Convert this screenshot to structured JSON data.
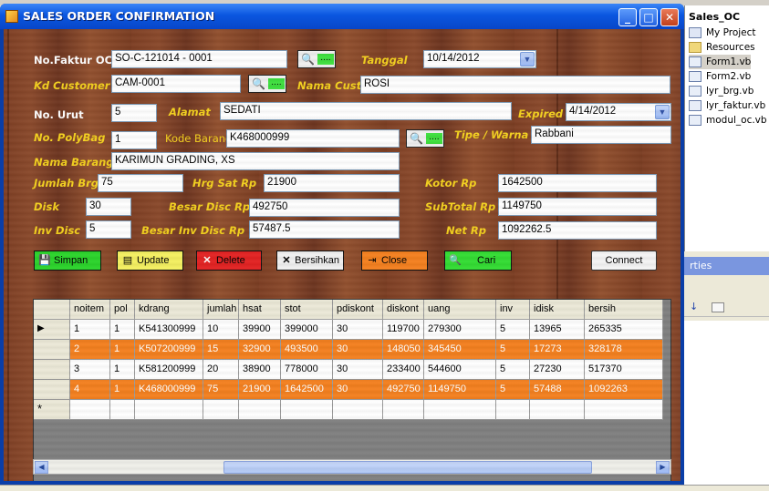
{
  "window": {
    "title": "SALES ORDER CONFIRMATION"
  },
  "solution": {
    "title": "Sales_OC",
    "items": [
      "My Project",
      "Resources",
      "Form1.vb",
      "Form2.vb",
      "lyr_brg.vb",
      "lyr_faktur.vb",
      "modul_oc.vb"
    ]
  },
  "props": {
    "title": "rties"
  },
  "labels": {
    "no_faktur": "No.Faktur OC",
    "tanggal": "Tanggal",
    "kd_customer": "Kd Customer",
    "nama_cust": "Nama Cust",
    "no_urut": "No. Urut",
    "alamat": "Alamat",
    "expired": "Expired",
    "no_polybag": "No. PolyBag",
    "kode_barang": "Kode Barang",
    "tipe_warna": "Tipe / Warna",
    "nama_barang": "Nama Barang",
    "jumlah_brg": "Jumlah Brg",
    "hrg_sat": "Hrg Sat  Rp",
    "kotor": "Kotor  Rp",
    "disk": "Disk",
    "besar_disc": "Besar Disc  Rp",
    "subtotal": "SubTotal  Rp",
    "inv_disc": "Inv Disc",
    "besar_inv_disc": "Besar Inv Disc  Rp",
    "net": "Net   Rp"
  },
  "fields": {
    "no_faktur": "SO-C-121014 - 0001",
    "tanggal": "10/14/2012",
    "kd_customer": "CAM-0001",
    "nama_cust": "ROSI",
    "no_urut": "5",
    "alamat": "SEDATI",
    "expired": "4/14/2012",
    "no_polybag": "1",
    "kode_barang": "K468000999",
    "tipe_warna": "Rabbani",
    "nama_barang": "KARIMUN GRADING, XS",
    "jumlah_brg": "75",
    "hrg_sat": "21900",
    "kotor": "1642500",
    "disk": "30",
    "besar_disc": "492750",
    "subtotal": "1149750",
    "inv_disc": "5",
    "besar_inv_disc": "57487.5",
    "net": "1092262.5"
  },
  "search_button_text": "....",
  "buttons": {
    "simpan": "Simpan",
    "update": "Update",
    "delete": "Delete",
    "bersihkan": "Bersihkan",
    "close": "Close",
    "cari": "Cari",
    "connect": "Connect"
  },
  "colors": {
    "simpan": "#2bd42b",
    "update": "#f4f060",
    "delete": "#e32222",
    "bersihkan": "#f0f0f0",
    "close": "#f4801f",
    "cari": "#33dd33",
    "connect": "#f4f4f4",
    "row_highlight": "#f4801f"
  },
  "grid": {
    "columns": [
      "noitem",
      "pol",
      "kdrang",
      "jumlah",
      "hsat",
      "stot",
      "pdiskont",
      "diskont",
      "uang",
      "inv",
      "idisk",
      "bersih"
    ],
    "rows": [
      [
        "1",
        "1",
        "K541300999",
        "10",
        "39900",
        "399000",
        "30",
        "119700",
        "279300",
        "5",
        "13965",
        "265335"
      ],
      [
        "2",
        "1",
        "K507200999",
        "15",
        "32900",
        "493500",
        "30",
        "148050",
        "345450",
        "5",
        "17273",
        "328178"
      ],
      [
        "3",
        "1",
        "K581200999",
        "20",
        "38900",
        "778000",
        "30",
        "233400",
        "544600",
        "5",
        "27230",
        "517370"
      ],
      [
        "4",
        "1",
        "K468000999",
        "75",
        "21900",
        "1642500",
        "30",
        "492750",
        "1149750",
        "5",
        "57488",
        "1092263"
      ]
    ],
    "current_row_marker": "▶",
    "new_row_marker": "*"
  }
}
